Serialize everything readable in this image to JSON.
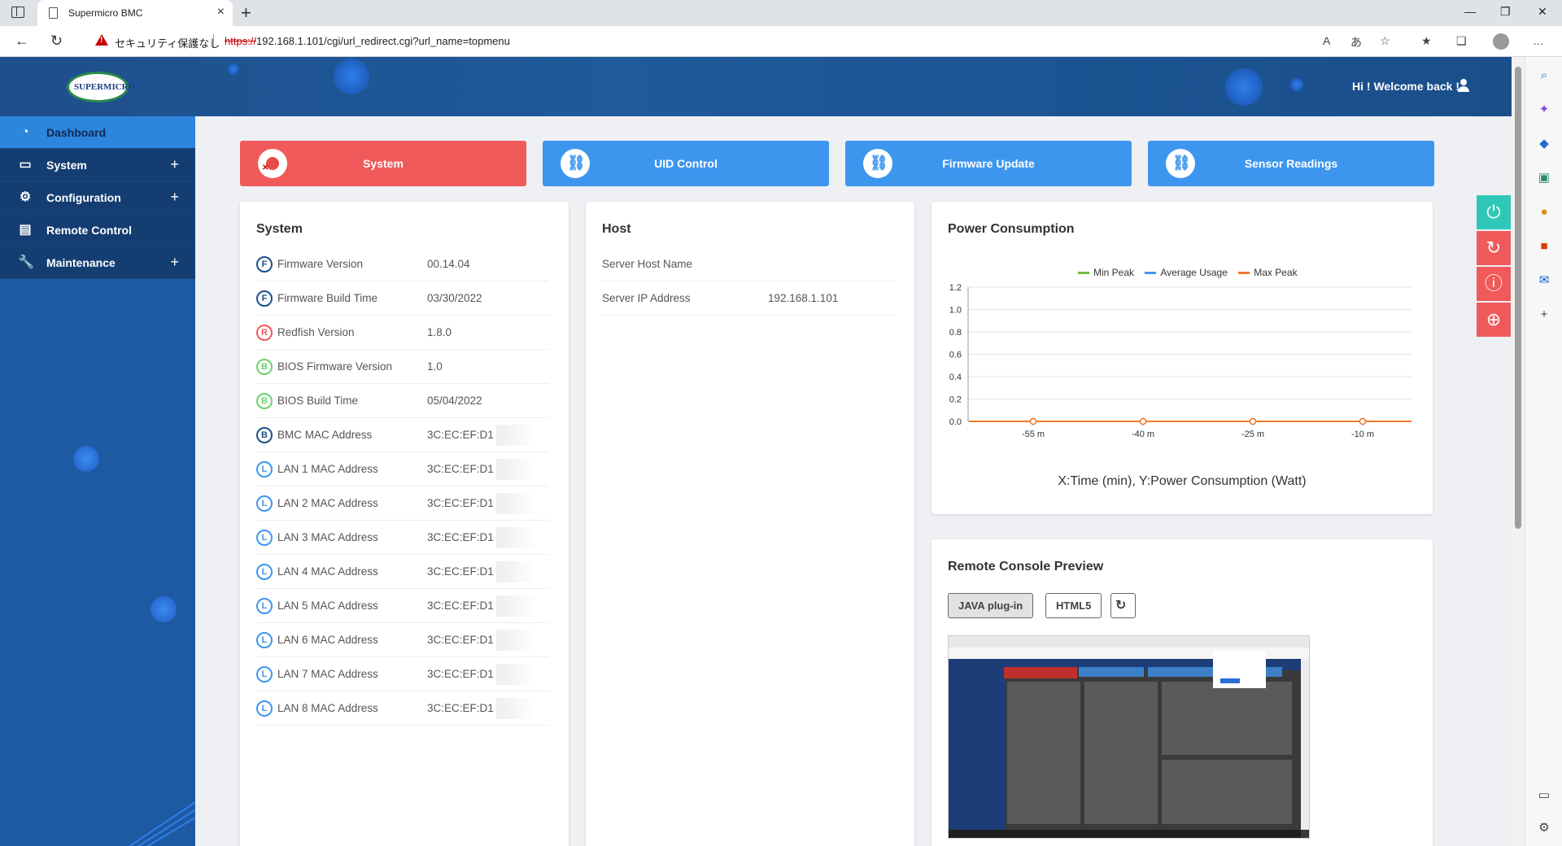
{
  "browser": {
    "tab_title": "Supermicro BMC",
    "security_label": "セキュリティ保護なし",
    "url_scheme": "https://",
    "url_rest": "192.168.1.101/cgi/url_redirect.cgi?url_name=topmenu"
  },
  "header": {
    "logo_text": "SUPERMICRO",
    "welcome": "Hi ! Welcome back !"
  },
  "sidebar": {
    "items": [
      {
        "label": "Dashboard",
        "icon": "dashboard-icon"
      },
      {
        "label": "System",
        "icon": "monitor-icon",
        "expand": "+"
      },
      {
        "label": "Configuration",
        "icon": "gear-icon",
        "expand": "+"
      },
      {
        "label": "Remote Control",
        "icon": "console-icon"
      },
      {
        "label": "Maintenance",
        "icon": "wrench-icon",
        "expand": "+"
      }
    ]
  },
  "quick_buttons": [
    {
      "label": "System",
      "color": "#f05a5a"
    },
    {
      "label": "UID Control",
      "color": "#3d96ee"
    },
    {
      "label": "Firmware Update",
      "color": "#3d96ee"
    },
    {
      "label": "Sensor Readings",
      "color": "#3d96ee"
    }
  ],
  "system_card": {
    "title": "System",
    "rows": [
      {
        "badge": "F",
        "badge_color": "#1d4f8c",
        "key": "Firmware Version",
        "value": "00.14.04"
      },
      {
        "badge": "F",
        "badge_color": "#1d4f8c",
        "key": "Firmware Build Time",
        "value": "03/30/2022"
      },
      {
        "badge": "R",
        "badge_color": "#f05a5a",
        "key": "Redfish Version",
        "value": "1.8.0"
      },
      {
        "badge": "B",
        "badge_color": "#6cd36c",
        "key": "BIOS Firmware Version",
        "value": "1.0"
      },
      {
        "badge": "B",
        "badge_color": "#6cd36c",
        "key": "BIOS Build Time",
        "value": "05/04/2022"
      },
      {
        "badge": "B",
        "badge_color": "#1d4f8c",
        "key": "BMC MAC Address",
        "value": "3C:EC:EF:D1"
      },
      {
        "badge": "L",
        "badge_color": "#3d96ee",
        "key": "LAN 1 MAC Address",
        "value": "3C:EC:EF:D1"
      },
      {
        "badge": "L",
        "badge_color": "#3d96ee",
        "key": "LAN 2 MAC Address",
        "value": "3C:EC:EF:D1"
      },
      {
        "badge": "L",
        "badge_color": "#3d96ee",
        "key": "LAN 3 MAC Address",
        "value": "3C:EC:EF:D1"
      },
      {
        "badge": "L",
        "badge_color": "#3d96ee",
        "key": "LAN 4 MAC Address",
        "value": "3C:EC:EF:D1"
      },
      {
        "badge": "L",
        "badge_color": "#3d96ee",
        "key": "LAN 5 MAC Address",
        "value": "3C:EC:EF:D1"
      },
      {
        "badge": "L",
        "badge_color": "#3d96ee",
        "key": "LAN 6 MAC Address",
        "value": "3C:EC:EF:D1"
      },
      {
        "badge": "L",
        "badge_color": "#3d96ee",
        "key": "LAN 7 MAC Address",
        "value": "3C:EC:EF:D1"
      },
      {
        "badge": "L",
        "badge_color": "#3d96ee",
        "key": "LAN 8 MAC Address",
        "value": "3C:EC:EF:D1"
      }
    ]
  },
  "host_card": {
    "title": "Host",
    "rows": [
      {
        "key": "Server Host Name",
        "value": ""
      },
      {
        "key": "Server IP Address",
        "value": "192.168.1.101"
      }
    ]
  },
  "power_card": {
    "title": "Power Consumption",
    "caption": "X:Time (min), Y:Power Consumption (Watt)"
  },
  "chart_data": {
    "type": "line",
    "categories": [
      "-55 m",
      "-40 m",
      "-25 m",
      "-10 m"
    ],
    "series": [
      {
        "name": "Min Peak",
        "color": "#6cbf3a",
        "values": [
          0,
          0,
          0,
          0
        ]
      },
      {
        "name": "Average Usage",
        "color": "#3d96ee",
        "values": [
          0,
          0,
          0,
          0
        ]
      },
      {
        "name": "Max Peak",
        "color": "#f07a30",
        "values": [
          0,
          0,
          0,
          0
        ]
      }
    ],
    "ylim": [
      0,
      1.2
    ],
    "yticks": [
      "1.2",
      "1.0",
      "0.8",
      "0.6",
      "0.4",
      "0.2",
      "0.0"
    ],
    "grid": true,
    "legend": "top-center"
  },
  "console_card": {
    "title": "Remote Console Preview",
    "java_label": "JAVA plug-in",
    "html5_label": "HTML5"
  },
  "floating_buttons": [
    {
      "icon": "power-icon",
      "color": "#2fc8b8"
    },
    {
      "icon": "refresh-icon",
      "color": "#f05a5a"
    },
    {
      "icon": "info-icon",
      "color": "#f05a5a"
    },
    {
      "icon": "globe-icon",
      "color": "#f05a5a"
    }
  ]
}
